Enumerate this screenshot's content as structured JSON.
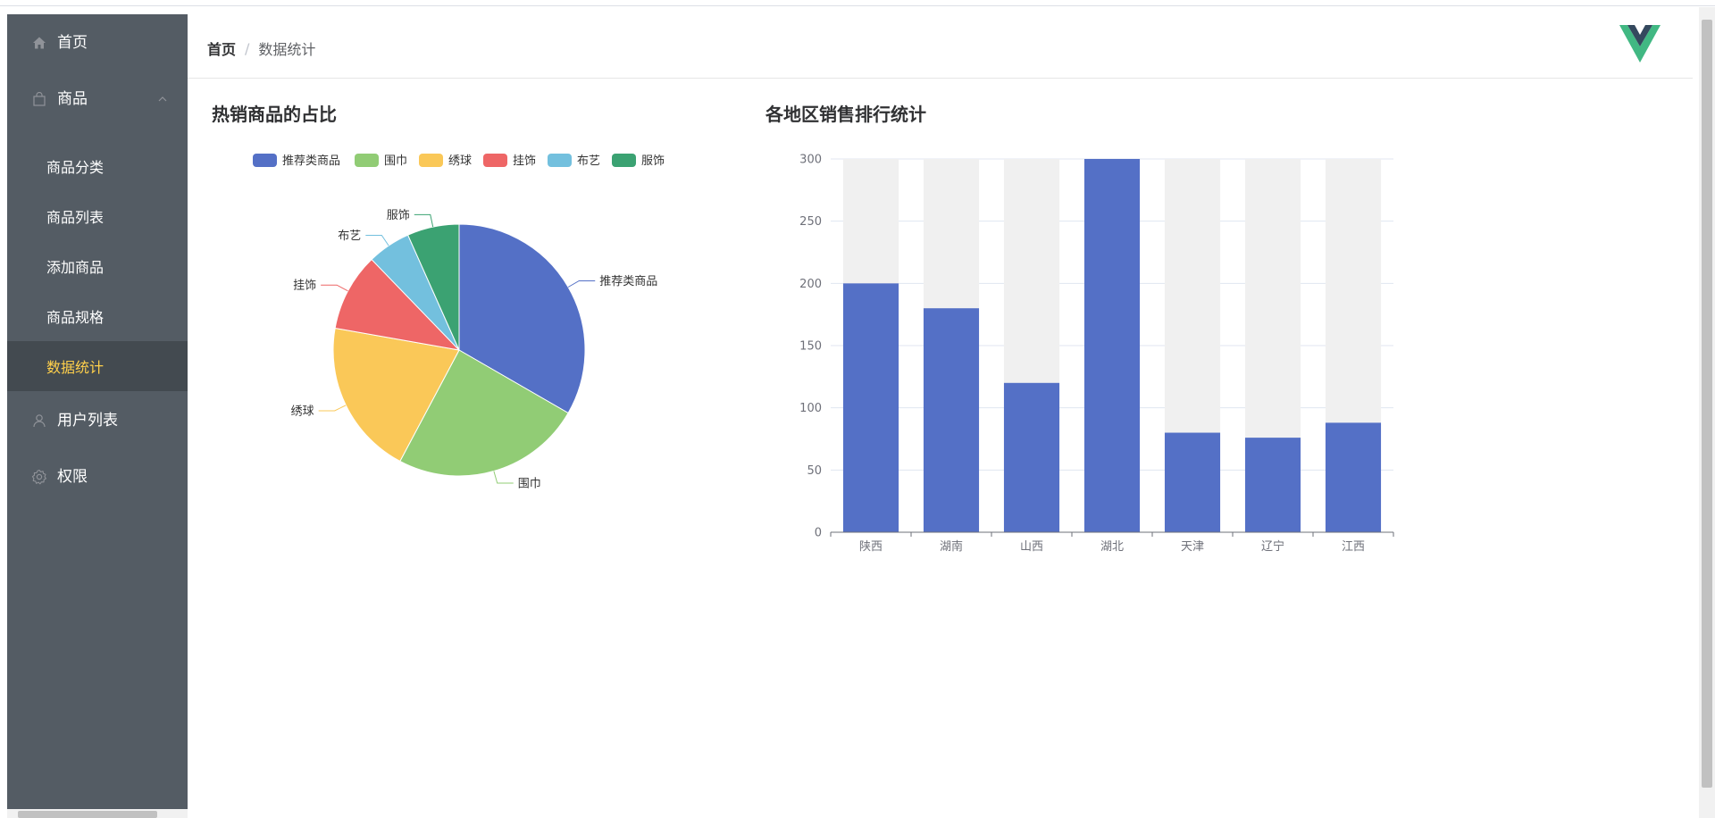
{
  "sidebar": {
    "items": [
      {
        "label": "首页",
        "icon": "home-icon"
      },
      {
        "label": "商品",
        "icon": "shopping-bag-icon",
        "expanded": true,
        "children": [
          {
            "label": "商品分类"
          },
          {
            "label": "商品列表"
          },
          {
            "label": "添加商品"
          },
          {
            "label": "商品规格"
          },
          {
            "label": "数据统计",
            "active": true
          }
        ]
      },
      {
        "label": "用户列表",
        "icon": "user-icon"
      },
      {
        "label": "权限",
        "icon": "gear-icon"
      }
    ],
    "background": "#545c64",
    "active_text_color": "#ffd04b"
  },
  "breadcrumb": {
    "home": "首页",
    "separator": "/",
    "current": "数据统计"
  },
  "logo": "vue-logo",
  "pie_panel": {
    "title": "热销商品的占比"
  },
  "bar_panel": {
    "title": "各地区销售排行统计"
  },
  "chart_data": [
    {
      "type": "pie",
      "title": "",
      "legend": "top",
      "series": [
        {
          "name": "推荐类商品",
          "value": 30,
          "color": "#5470c6"
        },
        {
          "name": "围巾",
          "value": 22,
          "color": "#91cc75"
        },
        {
          "name": "绣球",
          "value": 18,
          "color": "#fac858"
        },
        {
          "name": "挂饰",
          "value": 9,
          "color": "#ee6666"
        },
        {
          "name": "布艺",
          "value": 5,
          "color": "#73c0de"
        },
        {
          "name": "服饰",
          "value": 6,
          "color": "#3ba272"
        }
      ]
    },
    {
      "type": "bar",
      "title": "",
      "categories": [
        "陕西",
        "湖南",
        "山西",
        "湖北",
        "天津",
        "辽宁",
        "江西"
      ],
      "values": [
        200,
        180,
        120,
        300,
        80,
        76,
        88
      ],
      "ylim": [
        0,
        300
      ],
      "yticks": [
        0,
        50,
        100,
        150,
        200,
        250,
        300
      ],
      "bar_color": "#5470c6",
      "background_bar_color": "#f0f0f0",
      "grid": true
    }
  ]
}
